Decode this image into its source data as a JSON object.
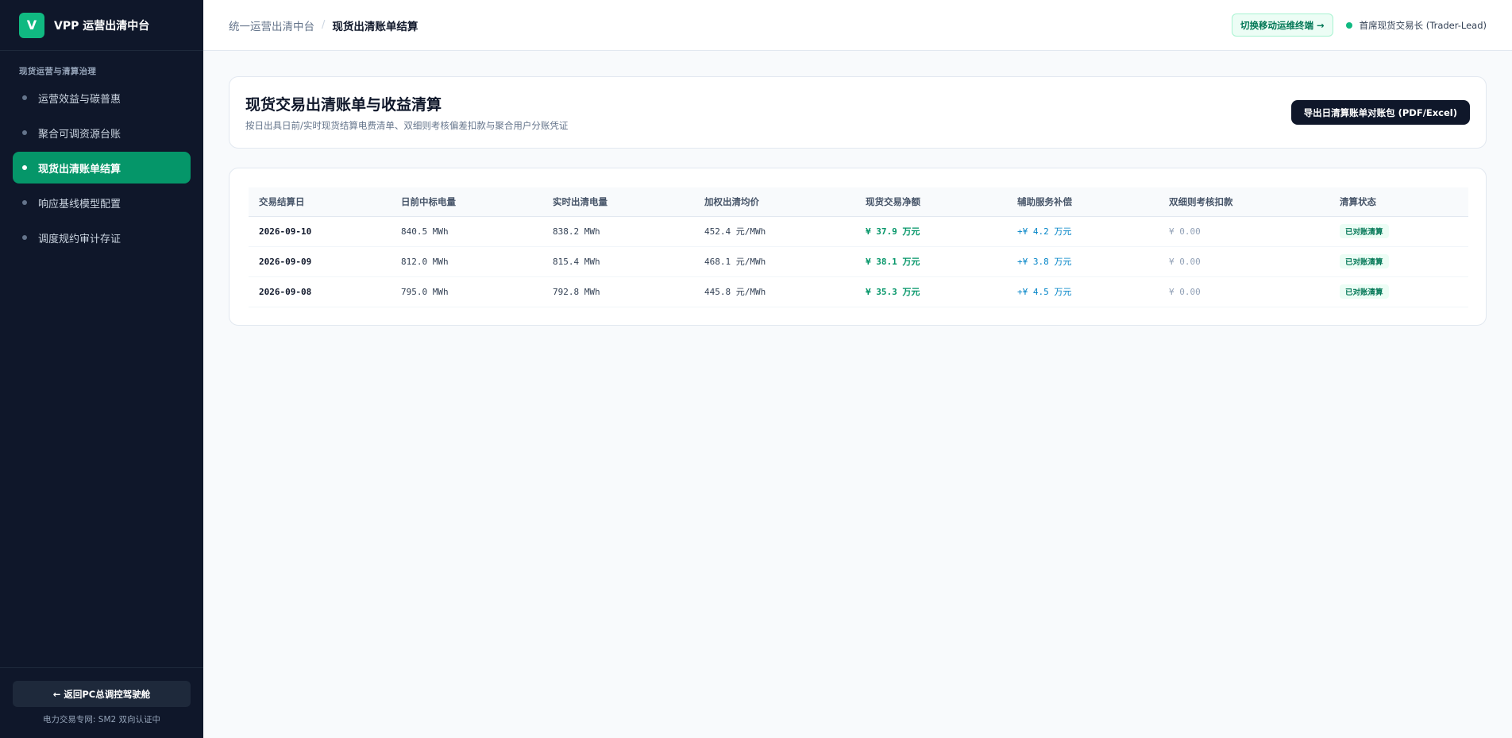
{
  "brand": {
    "logo": "V",
    "name": "VPP 运营出清中台"
  },
  "sidebar": {
    "section": "现货运营与清算治理",
    "items": [
      {
        "label": "运营效益与碳普惠"
      },
      {
        "label": "聚合可调资源台账"
      },
      {
        "label": "现货出清账单结算"
      },
      {
        "label": "响应基线模型配置"
      },
      {
        "label": "调度规约审计存证"
      }
    ],
    "back_label": "← 返回PC总调控驾驶舱",
    "footer_note": "电力交易专网: SM2 双向认证中"
  },
  "header": {
    "breadcrumb_root": "统一运营出清中台",
    "breadcrumb_sep": "/",
    "breadcrumb_current": "现货出清账单结算",
    "switch_label": "切换移动运维终端 →",
    "user": "首席现货交易长 (Trader-Lead)"
  },
  "page": {
    "title": "现货交易出清账单与收益清算",
    "subtitle": "按日出具日前/实时现货结算电费清单、双细则考核偏差扣款与聚合用户分账凭证",
    "export_label": "导出日清算账单对账包 (PDF/Excel)"
  },
  "table": {
    "columns": [
      "交易结算日",
      "日前中标电量",
      "实时出清电量",
      "加权出清均价",
      "现货交易净额",
      "辅助服务补偿",
      "双细则考核扣款",
      "清算状态"
    ],
    "rows": [
      [
        "2026-09-10",
        "840.5 MWh",
        "838.2 MWh",
        "452.4 元/MWh",
        "¥ 37.9 万元",
        "+¥ 4.2 万元",
        "¥ 0.00",
        "已对账清算"
      ],
      [
        "2026-09-09",
        "812.0 MWh",
        "815.4 MWh",
        "468.1 元/MWh",
        "¥ 38.1 万元",
        "+¥ 3.8 万元",
        "¥ 0.00",
        "已对账清算"
      ],
      [
        "2026-09-08",
        "795.0 MWh",
        "792.8 MWh",
        "445.8 元/MWh",
        "¥ 35.3 万元",
        "+¥ 4.5 万元",
        "¥ 0.00",
        "已对账清算"
      ]
    ]
  },
  "colors": {
    "accent": "#059669",
    "sidebar_bg": "#0f172a",
    "aux": "#0284c7"
  }
}
